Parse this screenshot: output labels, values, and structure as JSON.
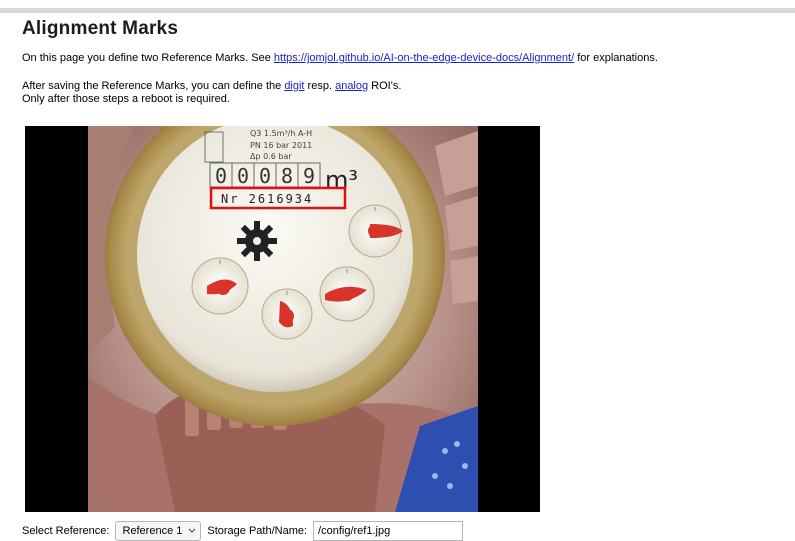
{
  "page": {
    "title": "Alignment Marks",
    "intro_prefix": "On this page you define two Reference Marks. See ",
    "intro_link": "https://jomjol.github.io/AI-on-the-edge-device-docs/Alignment/",
    "intro_suffix": " for explanations.",
    "after_prefix": "After saving the Reference Marks, you can define the ",
    "digit_link": "digit",
    "resp_text": " resp. ",
    "analog_link": "analog",
    "after_suffix": " ROI's.",
    "reboot_note": "Only after those steps a reboot is required."
  },
  "image": {
    "meter_header_1": "Q3 1.5m³/h  A-H",
    "meter_header_2": "PN 16 bar  2011",
    "meter_header_3": "Δp 0.6 bar",
    "counter_digits": [
      "0",
      "0",
      "0",
      "8",
      "9"
    ],
    "unit": "m³",
    "serial": "Nr  2616934",
    "highlight_color": "#e01010"
  },
  "controls": {
    "select_label": "Select Reference:",
    "select_value": "Reference 1",
    "path_label": "Storage Path/Name:",
    "path_value": "/config/ref1.jpg"
  }
}
